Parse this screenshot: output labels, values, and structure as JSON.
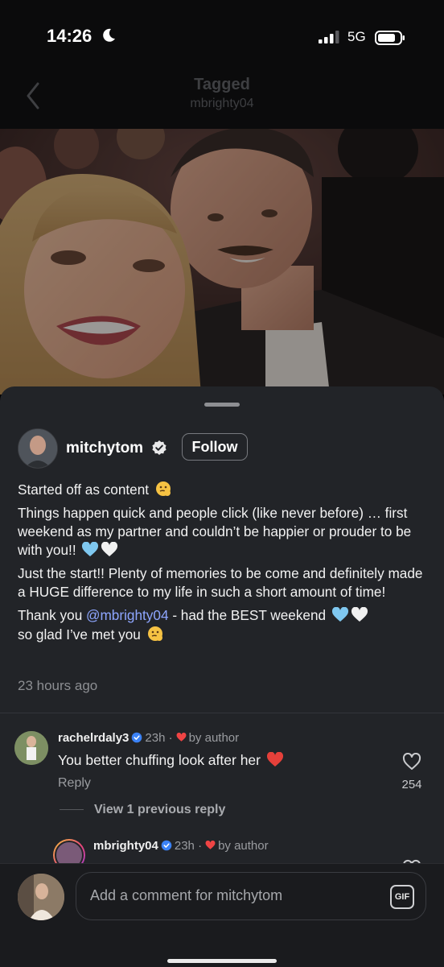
{
  "status_bar": {
    "time": "14:26",
    "network": "5G",
    "icons": [
      "moon-icon",
      "signal-icon",
      "battery-icon"
    ]
  },
  "header": {
    "title": "Tagged",
    "subtitle": "mbrighty04",
    "back_icon": "chevron-left-icon"
  },
  "post": {
    "author": "mitchytom",
    "verified": true,
    "follow_label": "Follow",
    "caption": {
      "p1": "Started off as content",
      "p2": "Things happen quick and people click (like never before) … first weekend as my partner and couldn’t be happier or prouder to be with you!!",
      "p3": "Just the start!! Plenty of memories to be come and definitely made a HUGE difference to my life in such a short amount of time!",
      "p4_pre": "Thank you",
      "p4_mention": "@mbrighty04",
      "p4_post": "- had the BEST weekend",
      "p5": "so glad I’ve met you"
    },
    "time_ago": "23 hours ago"
  },
  "comments": [
    {
      "user": "rachelrdaly3",
      "verified": true,
      "time": "23h",
      "separator": "·",
      "liked_by_author": "by author",
      "text": "You better chuffing look after her",
      "reply_label": "Reply",
      "like_count": "254",
      "view_replies": "View 1 previous reply"
    },
    {
      "user": "mbrighty04",
      "verified": true,
      "time": "23h",
      "separator": "·",
      "liked_by_author": "by author"
    }
  ],
  "compose": {
    "placeholder": "Add a comment for mitchytom",
    "gif_label": "GIF"
  },
  "colors": {
    "sheet": "#222428",
    "mention": "#8ea6ff",
    "verified": "#3b82f6",
    "heart": "#ef4444",
    "light_blue_heart": "#7fc8f0"
  }
}
